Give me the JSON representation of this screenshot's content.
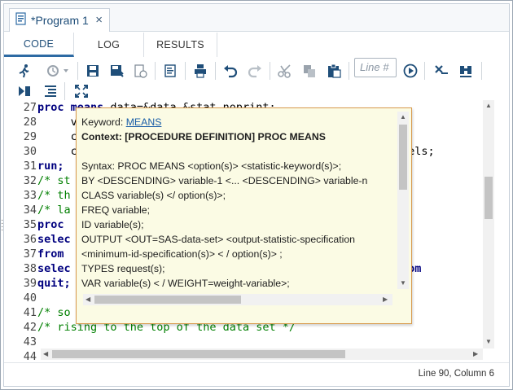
{
  "tab": {
    "title": "*Program 1",
    "close": "×"
  },
  "subtabs": [
    "CODE",
    "LOG",
    "RESULTS"
  ],
  "toolbar": {
    "line_placeholder": "Line #"
  },
  "code": {
    "line_numbers": [
      "27",
      "28",
      "29",
      "30",
      "31",
      "32",
      "33",
      "34",
      "35",
      "36",
      "37",
      "38",
      "39",
      "40",
      "41",
      "42",
      "43",
      "44"
    ],
    "lines": [
      [
        [
          "kw",
          "proc means "
        ],
        [
          "",
          "data=&data &stat noprint;"
        ]
      ],
      [
        [
          "",
          "     v"
        ]
      ],
      [
        [
          "",
          "     c"
        ]
      ],
      [
        [
          "",
          "     c                                              "
        ],
        [
          "",
          "/levels;"
        ]
      ],
      [
        [
          "kw",
          "run;"
        ]
      ],
      [
        [
          "cm",
          "/* st                                                nd"
        ]
      ],
      [
        [
          "cm",
          "/* th                                              */"
        ]
      ],
      [
        [
          "cm",
          "/* la"
        ]
      ],
      [
        [
          "kw",
          "proc"
        ]
      ],
      [
        [
          "kw",
          "selec"
        ]
      ],
      [
        [
          "kw",
          "from"
        ]
      ],
      [
        [
          "kw",
          "selec"
        ],
        [
          "",
          "                                            ount "
        ],
        [
          "kw",
          "from"
        ]
      ],
      [
        [
          "kw",
          "quit;"
        ]
      ],
      [
        [
          "",
          ""
        ]
      ],
      [
        [
          "cm",
          "/* so                                           s */"
        ]
      ],
      [
        [
          "cm",
          "/* rising to the top of the data set */"
        ]
      ],
      [
        [
          "",
          ""
        ]
      ],
      [
        [
          "",
          ""
        ]
      ]
    ]
  },
  "popup": {
    "keyword_label": "Keyword: ",
    "keyword": "MEANS",
    "context": "Context: [PROCEDURE DEFINITION] PROC MEANS",
    "syntax_lines": [
      "Syntax: PROC MEANS <option(s)> <statistic-keyword(s)>;",
      "     BY <DESCENDING> variable-1 <... <DESCENDING> variable-n",
      "     CLASS variable(s) </ option(s)>;",
      "     FREQ variable;",
      "     ID variable(s);",
      "     OUTPUT <OUT=SAS-data-set> <output-statistic-specification",
      "       <minimum-id-specification(s)> < / option(s)> ;",
      "     TYPES request(s);",
      "     VAR variable(s) < / WEIGHT=weight-variable>;"
    ]
  },
  "status": {
    "position": "Line 90, Column 6"
  },
  "colors": {
    "accent": "#2d6aa3",
    "popup_bg": "#fbfbe4",
    "popup_border": "#d89a4c",
    "keyword": "#00007f",
    "comment": "#007f00"
  }
}
